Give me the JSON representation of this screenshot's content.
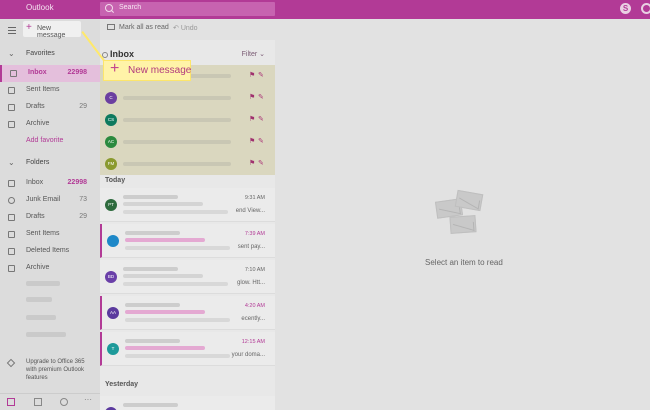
{
  "app": {
    "title": "Outlook"
  },
  "search": {
    "placeholder": "Search"
  },
  "toolbar": {
    "new_message": "New message",
    "mark_all_read": "Mark all as read",
    "undo": "Undo"
  },
  "favorites": {
    "header": "Favorites",
    "items": [
      {
        "label": "Inbox",
        "count": "22998",
        "selected": true
      },
      {
        "label": "Sent Items",
        "count": ""
      },
      {
        "label": "Drafts",
        "count": "29"
      },
      {
        "label": "Archive",
        "count": ""
      }
    ],
    "add_favorite": "Add favorite"
  },
  "folders": {
    "header": "Folders",
    "items": [
      {
        "label": "Inbox",
        "count": "22998"
      },
      {
        "label": "Junk Email",
        "count": "73"
      },
      {
        "label": "Drafts",
        "count": "29"
      },
      {
        "label": "Sent Items",
        "count": ""
      },
      {
        "label": "Deleted Items",
        "count": ""
      },
      {
        "label": "Archive",
        "count": ""
      }
    ]
  },
  "upgrade_text": "Upgrade to Office 365 with premium Outlook features",
  "message_list": {
    "title": "Inbox",
    "filter": "Filter",
    "pinned": [
      {
        "avatar": ""
      },
      {
        "avatar": "C"
      },
      {
        "avatar": "CS"
      },
      {
        "avatar": "AC"
      },
      {
        "avatar": "FM"
      }
    ],
    "today_label": "Today",
    "today": [
      {
        "avatar": "PT",
        "time": "9:31 AM",
        "snippet": "end View...",
        "unread": false
      },
      {
        "avatar": "",
        "time": "7:39 AM",
        "snippet": "sent pay...",
        "unread": true
      },
      {
        "avatar": "BD",
        "time": "7:10 AM",
        "snippet": "glow. Htt...",
        "unread": false
      },
      {
        "avatar": "AA",
        "time": "4:20 AM",
        "snippet": "ecently...",
        "unread": true
      },
      {
        "avatar": "T",
        "time": "12:15 AM",
        "snippet": "your doma...",
        "unread": true
      }
    ],
    "yesterday_label": "Yesterday",
    "yesterday": [
      {
        "avatar": "AA"
      }
    ]
  },
  "reading_pane": {
    "empty_text": "Select an item to read"
  },
  "callout": {
    "label": "New message"
  },
  "colors": {
    "accent": "#b23a96",
    "highlight": "#fff3a8"
  }
}
